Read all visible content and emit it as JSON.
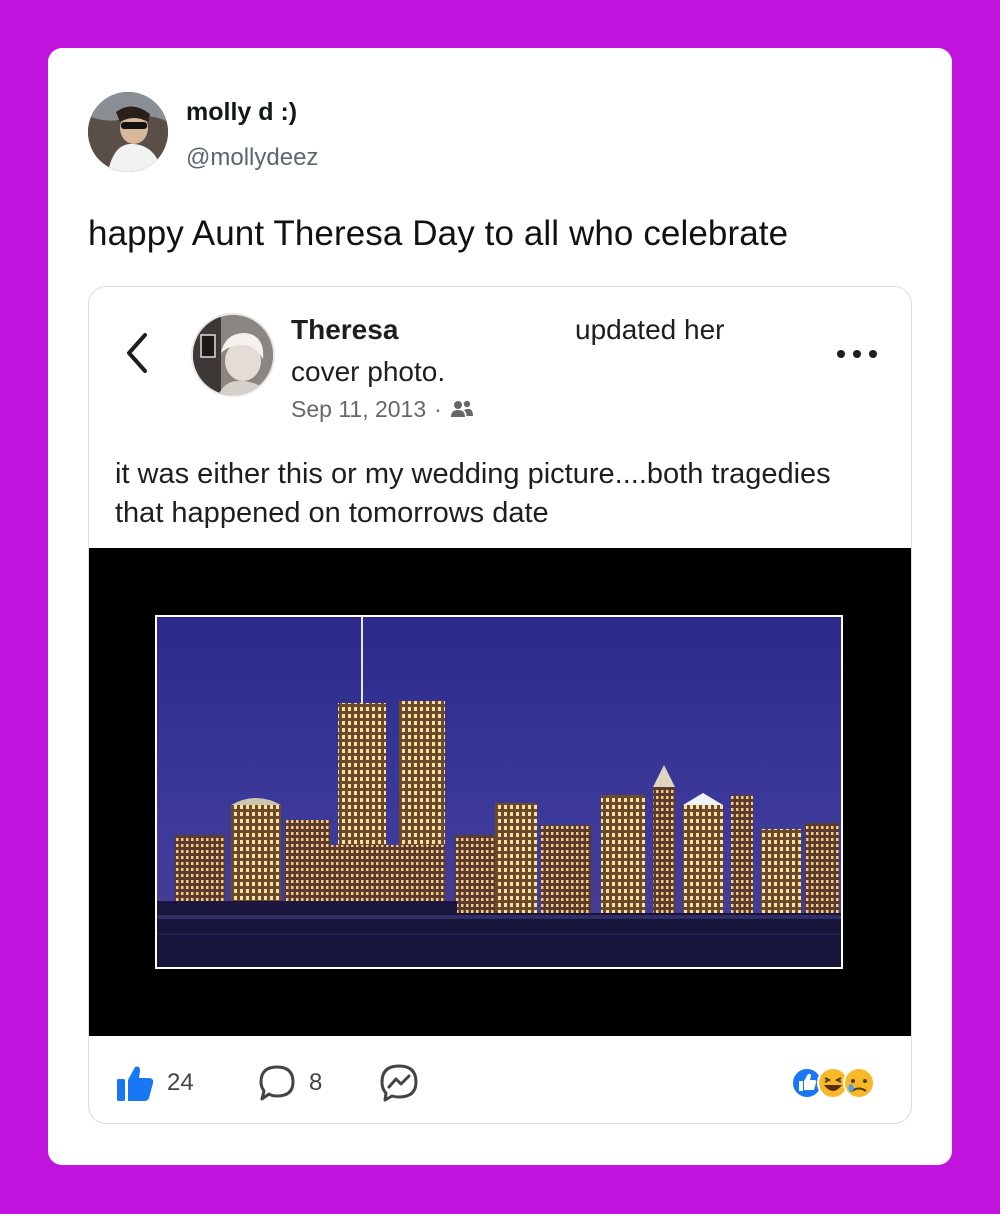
{
  "tweet": {
    "display_name": "molly d :)",
    "handle": "@mollydeez",
    "text": "happy Aunt Theresa Day to all who celebrate"
  },
  "embed": {
    "name_visible": "Theresa",
    "name_rest": "updated her",
    "line2": "cover photo.",
    "date": "Sep 11, 2013",
    "date_separator": "·",
    "audience_icon": "friends-icon",
    "post_text": "it was either this or my wedding picture....both tragedies that happened on tomorrows date",
    "likes": "24",
    "comments": "8",
    "reactions": [
      "like",
      "haha",
      "sad"
    ],
    "colors": {
      "background": "#c014de",
      "like_blue": "#1877f2",
      "sky": "#2e2a86"
    }
  }
}
